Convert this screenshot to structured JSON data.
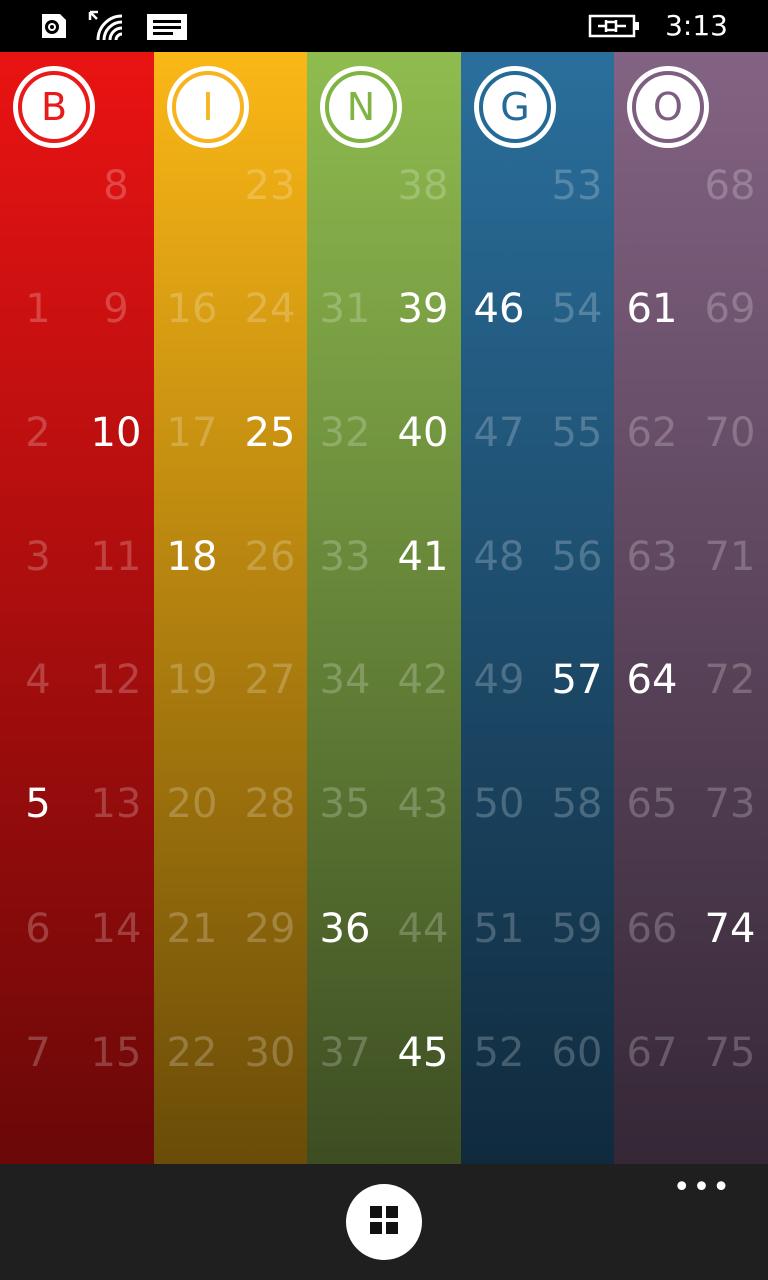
{
  "status": {
    "time": "3:13",
    "icons": [
      "sim-icon",
      "wifi-icon",
      "message-icon",
      "battery-charging-icon"
    ]
  },
  "columns": [
    {
      "letter": "B",
      "top": "#ea1313",
      "bottom": "#6a0808",
      "accent": "#e81a1a",
      "numbers": [
        1,
        2,
        3,
        4,
        5,
        6,
        7,
        8,
        9,
        10,
        11,
        12,
        13,
        14,
        15
      ],
      "called": [
        5,
        10
      ]
    },
    {
      "letter": "I",
      "top": "#fbb716",
      "bottom": "#6a4c08",
      "accent": "#f7b41c",
      "numbers": [
        16,
        17,
        18,
        19,
        20,
        21,
        22,
        23,
        24,
        25,
        26,
        27,
        28,
        29,
        30
      ],
      "called": [
        18,
        25
      ]
    },
    {
      "letter": "N",
      "top": "#8fbc4f",
      "bottom": "#3d4d22",
      "accent": "#7fb443",
      "numbers": [
        31,
        32,
        33,
        34,
        35,
        36,
        37,
        38,
        39,
        40,
        41,
        42,
        43,
        44,
        45
      ],
      "called": [
        36,
        39,
        40,
        41,
        45
      ]
    },
    {
      "letter": "G",
      "top": "#2a6f9c",
      "bottom": "#102a3d",
      "accent": "#236a97",
      "numbers": [
        46,
        47,
        48,
        49,
        50,
        51,
        52,
        53,
        54,
        55,
        56,
        57,
        58,
        59,
        60
      ],
      "called": [
        46,
        57
      ]
    },
    {
      "letter": "O",
      "top": "#836383",
      "bottom": "#352736",
      "accent": "#7d5e80",
      "numbers": [
        61,
        62,
        63,
        64,
        65,
        66,
        67,
        68,
        69,
        70,
        71,
        72,
        73,
        74,
        75
      ],
      "called": [
        61,
        64,
        74
      ]
    }
  ],
  "app_bar": {
    "main_button_icon": "grid-icon",
    "more_label": "•••"
  }
}
